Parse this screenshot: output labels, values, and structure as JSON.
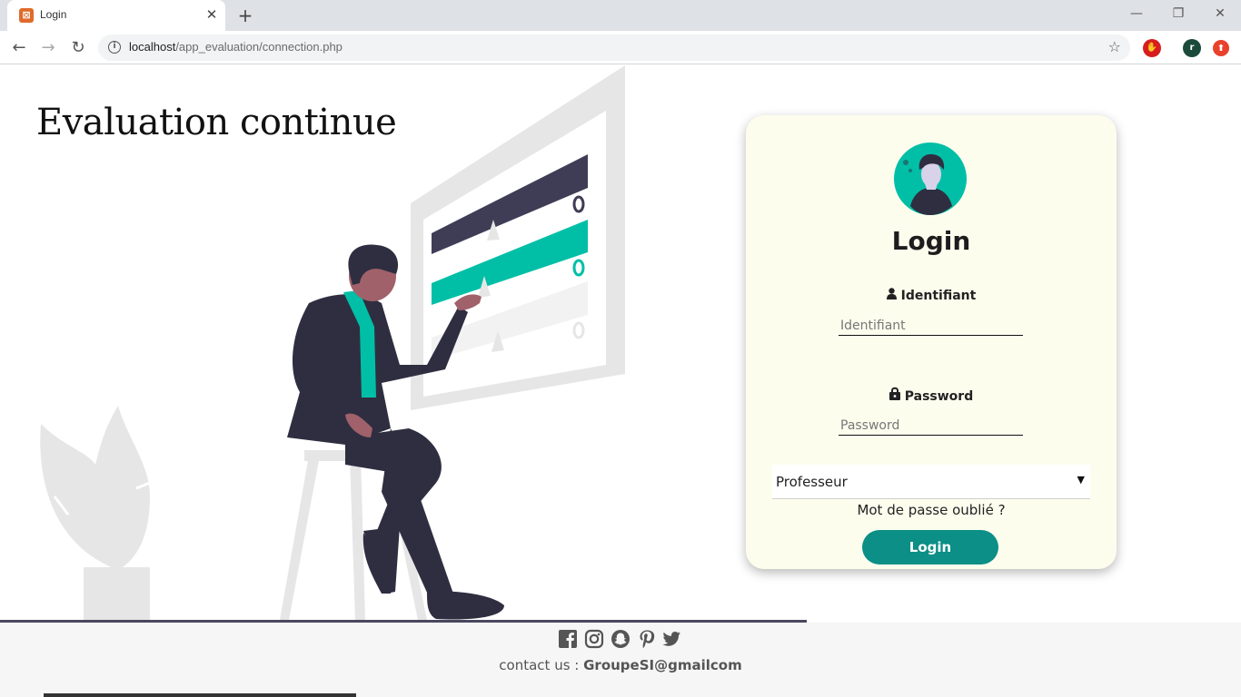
{
  "browser": {
    "tab_title": "Login",
    "url_host": "localhost",
    "url_path": "/app_evaluation/connection.php",
    "extension_badge": "r"
  },
  "page": {
    "headline": "Evaluation continue"
  },
  "login": {
    "title": "Login",
    "identifiant_label": "Identifiant",
    "identifiant_placeholder": "Identifiant",
    "password_label": "Password",
    "password_placeholder": "Password",
    "role_selected": "Professeur",
    "forgot_link": "Mot de passe oublié ?",
    "submit_label": "Login"
  },
  "footer": {
    "contact_prefix": "contact us : ",
    "email": "GroupeSI@gmailcom",
    "social_icons": [
      "facebook-icon",
      "instagram-icon",
      "snapchat-icon",
      "pinterest-icon",
      "twitter-icon"
    ]
  },
  "colors": {
    "accent": "#0b8f86",
    "teal": "#00bfa6",
    "dark": "#2f2e41",
    "card_bg": "#fdfdee"
  }
}
